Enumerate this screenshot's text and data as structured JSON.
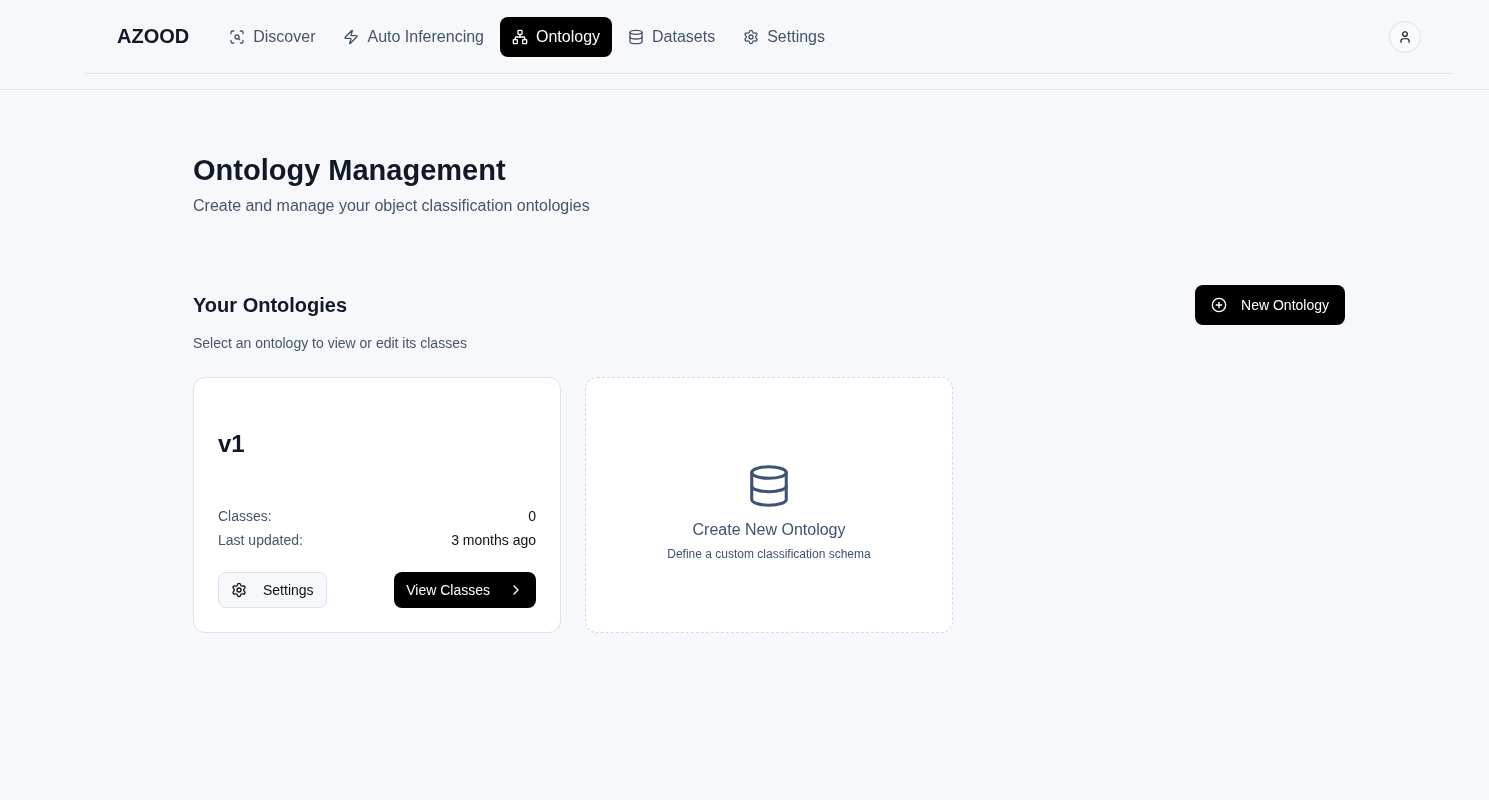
{
  "brand": "AZOOD",
  "nav": [
    {
      "label": "Discover",
      "kind": "discover",
      "selected": false
    },
    {
      "label": "Auto Inferencing",
      "kind": "inference",
      "selected": false
    },
    {
      "label": "Ontology",
      "kind": "ontology",
      "selected": true
    },
    {
      "label": "Datasets",
      "kind": "datasets",
      "selected": false
    },
    {
      "label": "Settings",
      "kind": "settings",
      "selected": false
    }
  ],
  "page": {
    "title": "Ontology Management",
    "subtitle": "Create and manage your object classification ontologies"
  },
  "section": {
    "title": "Your Ontologies",
    "hint": "Select an ontology to view or edit its classes",
    "new_button": "New Ontology"
  },
  "ontologies": [
    {
      "name": "v1",
      "stats": [
        {
          "label": "Classes:",
          "value": "0"
        },
        {
          "label": "Last updated:",
          "value": "3 months ago"
        }
      ],
      "settings_button": "Settings",
      "view_button": "View Classes"
    }
  ],
  "create_card": {
    "title": "Create New Ontology",
    "description": "Define a custom classification schema"
  }
}
